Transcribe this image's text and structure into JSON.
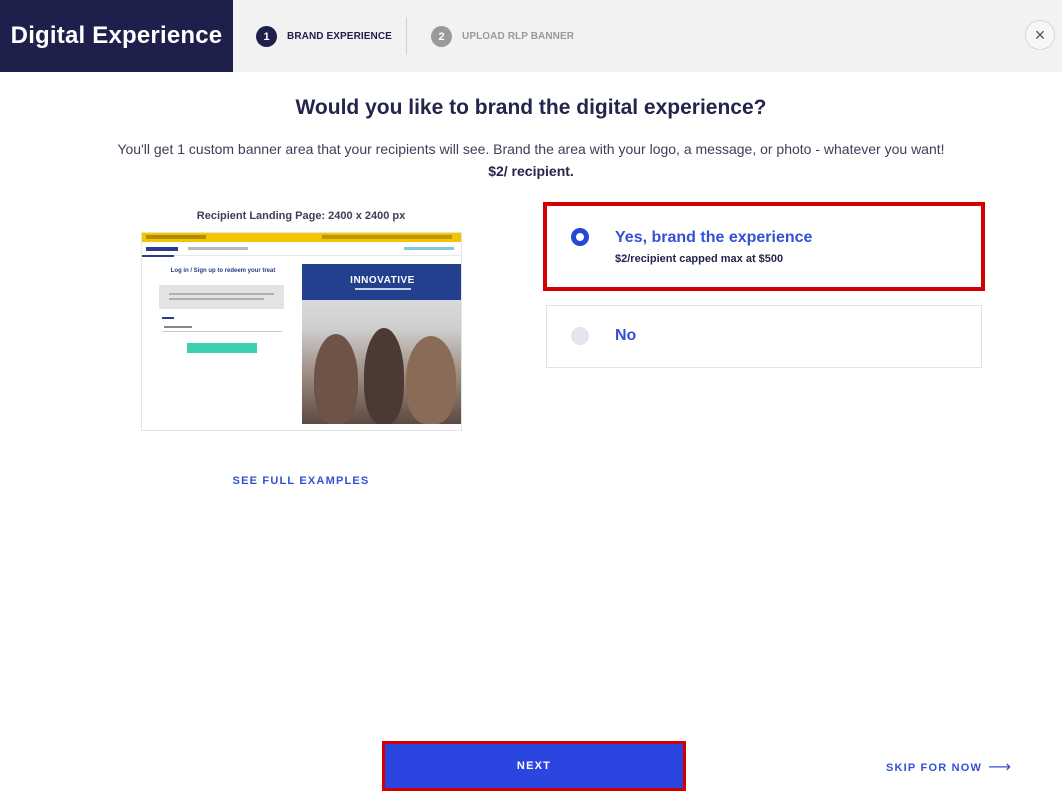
{
  "header": {
    "title": "Digital Experience",
    "steps": [
      {
        "number": "1",
        "label": "BRAND EXPERIENCE",
        "state": "active"
      },
      {
        "number": "2",
        "label": "UPLOAD RLP BANNER",
        "state": "inactive"
      }
    ],
    "close_icon": "close-icon",
    "close_glyph": "×"
  },
  "main": {
    "title": "Would you like to brand the digital experience?",
    "subtitle": "You'll get 1 custom banner area that your recipients will see. Brand the area with your logo, a message, or photo - whatever you want!",
    "price": "$2/ recipient."
  },
  "preview": {
    "label": "Recipient Landing Page: 2400 x 2400 px",
    "form_title": "Log in / Sign up to redeem your treat",
    "banner_text": "INNOVATIVE",
    "see_examples": "SEE FULL EXAMPLES"
  },
  "options": {
    "yes": {
      "title": "Yes, brand the experience",
      "subtitle": "$2/recipient capped max at $500",
      "selected": true
    },
    "no": {
      "title": "No",
      "selected": false
    }
  },
  "footer": {
    "next_label": "NEXT",
    "skip_label": "SKIP FOR NOW",
    "skip_arrow": "⟶"
  },
  "colors": {
    "brand_dark": "#1e1f4b",
    "accent_blue": "#2b46e0",
    "highlight_red": "#d40000"
  }
}
